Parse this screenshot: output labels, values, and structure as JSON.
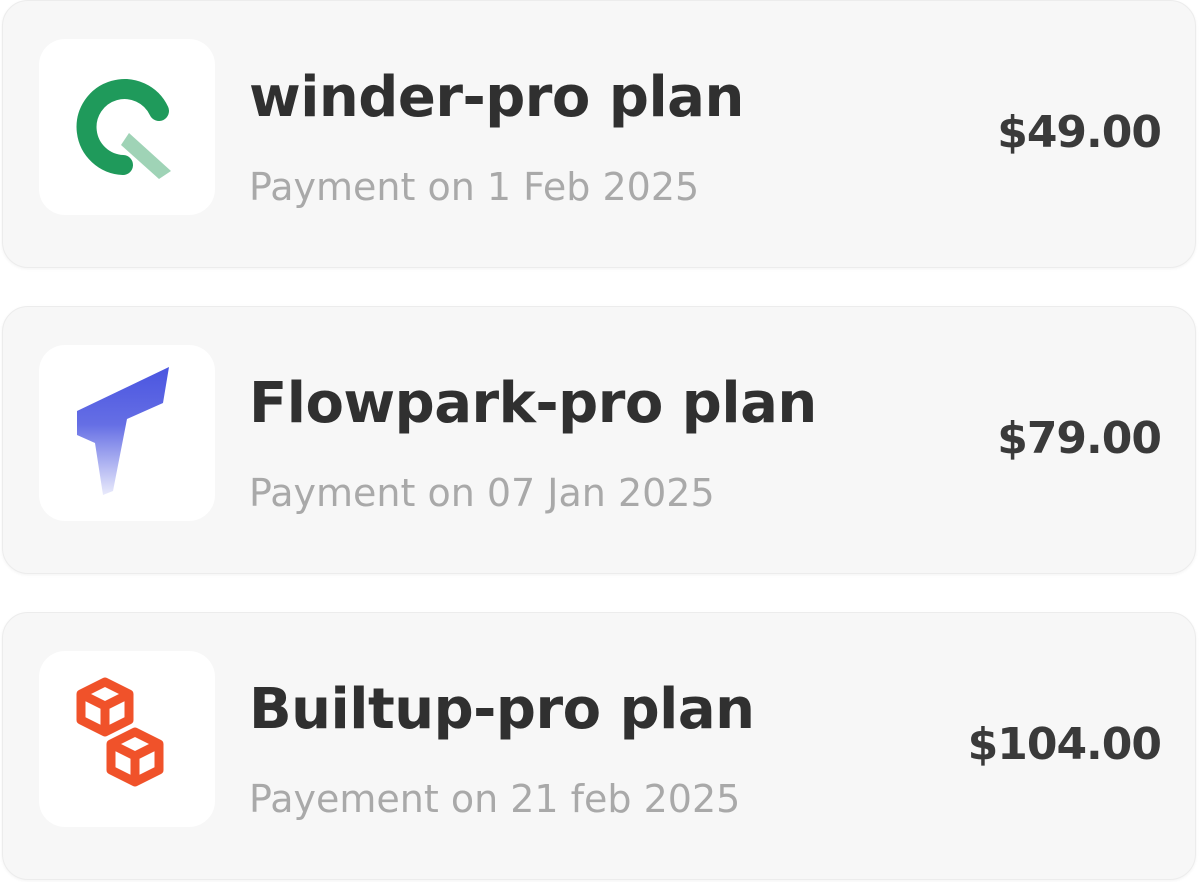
{
  "subscriptions": [
    {
      "logo_icon": "winder-logo-icon",
      "logo_color": "#1f9a5b",
      "name": "winder-pro plan",
      "date": "Payment on 1 Feb 2025",
      "price": "$49.00"
    },
    {
      "logo_icon": "flowpark-logo-icon",
      "logo_color": "#4a55e0",
      "name": "Flowpark-pro plan",
      "date": "Payment on 07 Jan 2025",
      "price": "$79.00"
    },
    {
      "logo_icon": "builtup-logo-icon",
      "logo_color": "#f0522a",
      "name": "Builtup-pro plan",
      "date": "Payement on 21 feb 2025",
      "price": "$104.00"
    }
  ]
}
